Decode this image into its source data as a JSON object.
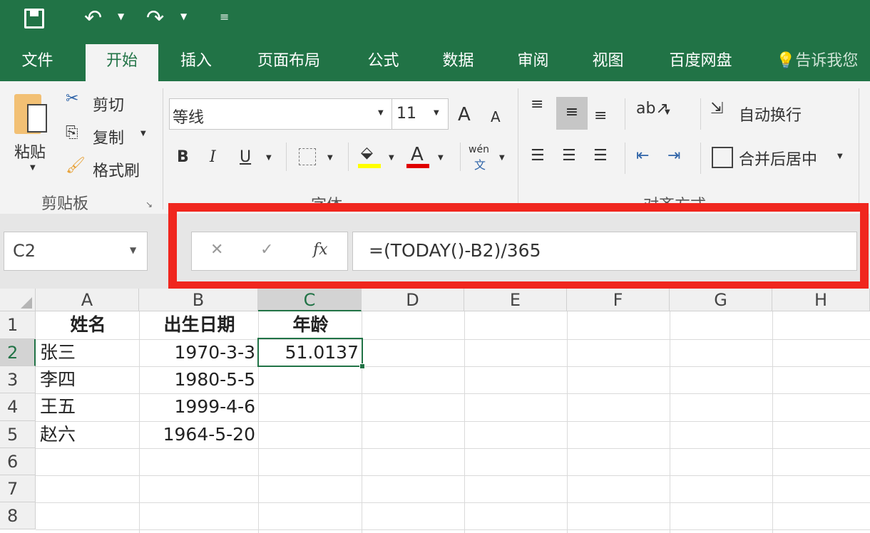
{
  "qat": {
    "save_icon": "save-icon",
    "undo_icon": "undo-icon",
    "redo_icon": "redo-icon",
    "customize_icon": "customize-icon"
  },
  "tabs": [
    "文件",
    "开始",
    "插入",
    "页面布局",
    "公式",
    "数据",
    "审阅",
    "视图",
    "百度网盘"
  ],
  "active_tab": "开始",
  "tell_me": "告诉我您",
  "clipboard": {
    "paste": "粘贴",
    "cut": "剪切",
    "copy": "复制",
    "format_painter": "格式刷",
    "group": "剪贴板"
  },
  "font": {
    "name": "等线",
    "size": "11",
    "grow": "A",
    "shrink": "A",
    "bold": "B",
    "italic": "I",
    "underline": "U",
    "font_color": "A",
    "phonetic_top": "wén",
    "phonetic_bottom": "文",
    "group": "字体",
    "highlight_color": "#ffff00",
    "font_color_hex": "#e00000"
  },
  "alignment": {
    "wrap": "自动换行",
    "merge": "合并后居中",
    "group": "对齐方式"
  },
  "formula_bar": {
    "name_box": "C2",
    "cancel": "✕",
    "enter": "✓",
    "fx": "fx",
    "formula": "=(TODAY()-B2)/365",
    "highlight_color": "#f0261e"
  },
  "columns": [
    "A",
    "B",
    "C",
    "D",
    "E",
    "F",
    "G",
    "H"
  ],
  "rows": [
    "1",
    "2",
    "3",
    "4",
    "5",
    "6",
    "7",
    "8"
  ],
  "cells": {
    "A1": "姓名",
    "B1": "出生日期",
    "C1": "年龄",
    "A2": "张三",
    "B2": "1970-3-3",
    "C2": "51.0137",
    "A3": "李四",
    "B3": "1980-5-5",
    "A4": "王五",
    "B4": "1999-4-6",
    "A5": "赵六",
    "B5": "1964-5-20"
  },
  "accent": "#217346"
}
